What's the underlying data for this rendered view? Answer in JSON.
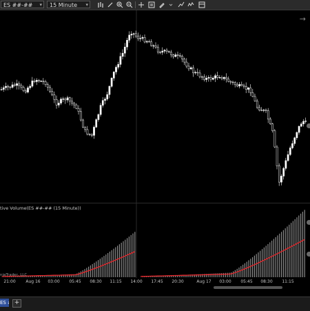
{
  "toolbar": {
    "instrument": "ES ##-##",
    "interval": "15 Minute",
    "icons": [
      "bar-type-icon",
      "draw-icon",
      "zoom-in-icon",
      "zoom-out-icon",
      "crosshair-icon",
      "data-box-icon",
      "drawing-tools-icon",
      "strategy-icon",
      "properties-icon"
    ]
  },
  "chart": {
    "indicator_label": "tive Volume(ES ##-## (15 Minute))",
    "copyright": "njaTrader, LLC",
    "colors": {
      "background": "#000000",
      "up_candle": "#ffffff",
      "down_candle": "#000000",
      "wick": "#ffffff",
      "volume_bar": "#8c8c8c",
      "volume_line": "#e8262b"
    },
    "x_ticks": [
      "21:00",
      "Aug 16",
      "03:00",
      "05:45",
      "08:30",
      "11:15",
      "14:00",
      "17:45",
      "20:30",
      "Aug 17",
      "03:00",
      "05:45",
      "08:30",
      "11:15"
    ]
  },
  "tabs": {
    "active_label": "ES ##-##",
    "add_label": "+"
  }
}
